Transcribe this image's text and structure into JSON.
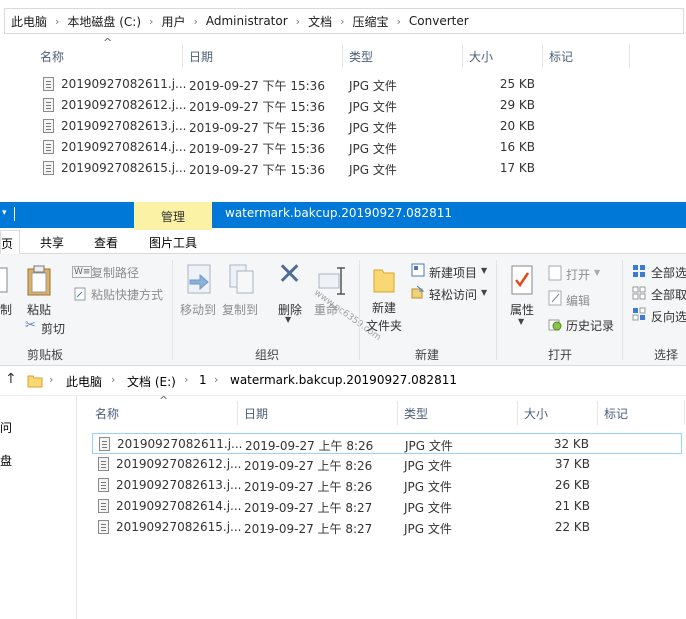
{
  "top_window": {
    "breadcrumb": [
      "此电脑",
      "本地磁盘 (C:)",
      "用户",
      "Administrator",
      "文档",
      "压缩宝",
      "Converter"
    ],
    "columns": {
      "name": "名称",
      "date": "日期",
      "type": "类型",
      "size": "大小",
      "tags": "标记"
    },
    "files": [
      {
        "name": "20190927082611.j...",
        "date": "2019-09-27 下午 15:36",
        "type": "JPG 文件",
        "size": "25 KB"
      },
      {
        "name": "20190927082612.j...",
        "date": "2019-09-27 下午 15:36",
        "type": "JPG 文件",
        "size": "29 KB"
      },
      {
        "name": "20190927082613.j...",
        "date": "2019-09-27 下午 15:36",
        "type": "JPG 文件",
        "size": "20 KB"
      },
      {
        "name": "20190927082614.j...",
        "date": "2019-09-27 下午 15:36",
        "type": "JPG 文件",
        "size": "16 KB"
      },
      {
        "name": "20190927082615.j...",
        "date": "2019-09-27 下午 15:36",
        "type": "JPG 文件",
        "size": "17 KB"
      }
    ]
  },
  "front_window": {
    "context_tab": "管理",
    "title": "watermark.bakcup.20190927.082811",
    "tabs": {
      "page": "页",
      "share": "共享",
      "view": "查看",
      "picture_tools": "图片工具"
    },
    "ribbon": {
      "copy": "制",
      "paste": "粘贴",
      "copy_path": "复制路径",
      "paste_shortcut": "粘贴快捷方式",
      "cut": "剪切",
      "clipboard": "剪贴板",
      "move_to": "移动到",
      "copy_to": "复制到",
      "delete": "删除",
      "rename": "重命",
      "organize": "组织",
      "new_folder_1": "新建",
      "new_folder_2": "文件夹",
      "new_item": "新建项目",
      "easy_access": "轻松访问",
      "new": "新建",
      "properties": "属性",
      "open": "打开",
      "edit": "编辑",
      "history": "历史记录",
      "open_group": "打开",
      "select_all": "全部选",
      "select_none": "全部取",
      "invert": "反向选",
      "select": "选择"
    },
    "breadcrumb": [
      "此电脑",
      "文档 (E:)",
      "1",
      "watermark.bakcup.20190927.082811"
    ],
    "nav_items": [
      "问",
      "盘"
    ],
    "columns": {
      "name": "名称",
      "date": "日期",
      "type": "类型",
      "size": "大小",
      "tags": "标记"
    },
    "files": [
      {
        "name": "20190927082611.j...",
        "date": "2019-09-27 上午 8:26",
        "type": "JPG 文件",
        "size": "32 KB"
      },
      {
        "name": "20190927082612.j...",
        "date": "2019-09-27 上午 8:26",
        "type": "JPG 文件",
        "size": "37 KB"
      },
      {
        "name": "20190927082613.j...",
        "date": "2019-09-27 上午 8:26",
        "type": "JPG 文件",
        "size": "26 KB"
      },
      {
        "name": "20190927082614.j...",
        "date": "2019-09-27 上午 8:27",
        "type": "JPG 文件",
        "size": "21 KB"
      },
      {
        "name": "20190927082615.j...",
        "date": "2019-09-27 上午 8:27",
        "type": "JPG 文件",
        "size": "22 KB"
      }
    ],
    "watermark": "www.pc6359.com"
  }
}
